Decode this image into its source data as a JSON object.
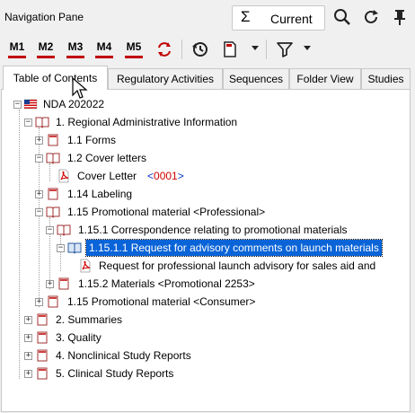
{
  "window": {
    "title": "Navigation Pane"
  },
  "toolbar": {
    "current_label": "Current",
    "sigma": "Σ",
    "milestones": [
      "M1",
      "M2",
      "M3",
      "M4",
      "M5"
    ]
  },
  "tabs": [
    "Table of Contents",
    "Regulatory Activities",
    "Sequences",
    "Folder View",
    "Studies"
  ],
  "tree": {
    "root": "NDA 202022",
    "n1": "1. Regional Administrative Information",
    "n11": "1.1 Forms",
    "n12": "1.2 Cover letters",
    "cover_letter": "Cover Letter",
    "cover_seq": "<0001>",
    "n114": "1.14 Labeling",
    "n115a": "1.15 Promotional material <Professional>",
    "n1151": "1.15.1 Correspondence relating to promotional materials",
    "n11511": "1.15.1.1 Request for advisory comments on launch materials",
    "request_doc": "Request for professional launch advisory for sales aid and",
    "n1152": "1.15.2 Materials <Promotional 2253>",
    "n115b": "1.15 Promotional material <Consumer>",
    "n2": "2. Summaries",
    "n3": "3. Quality",
    "n4": "4. Nonclinical Study Reports",
    "n5": "5. Clinical Study Reports"
  },
  "colors": {
    "selection": "#0a64d8",
    "milestone_bar": "#c00000",
    "pdf_red": "#d00000",
    "seq_blue": "#0033cc"
  }
}
